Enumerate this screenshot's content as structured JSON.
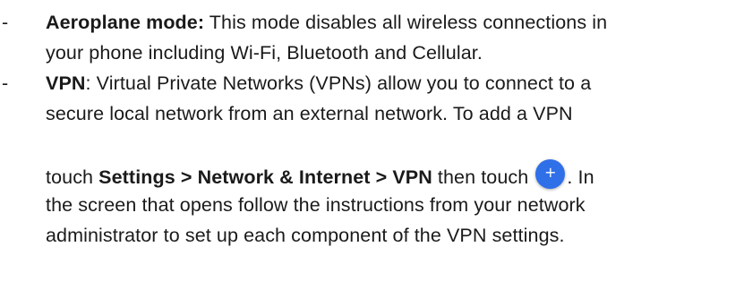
{
  "items": [
    {
      "bullet": "-",
      "title": "Aeroplane mode:",
      "line1_rest": " This mode disables all wireless connections in",
      "line2": "your phone including Wi-Fi, Bluetooth and Cellular."
    },
    {
      "bullet": "-",
      "title": "VPN",
      "line1_rest": ": Virtual Private Networks (VPNs) allow you to connect to a",
      "line2": "secure local network from an external network. To add a VPN",
      "line3_pre": "touch ",
      "line3_path": "Settings > Network & Internet > VPN",
      "line3_mid": " then touch",
      "line3_post": ". In",
      "line4": "the screen that opens follow the instructions from your network",
      "line5": "administrator to set up each component of the VPN settings.",
      "add_icon_glyph": "+",
      "add_icon_color": "#2f6fe8"
    }
  ]
}
